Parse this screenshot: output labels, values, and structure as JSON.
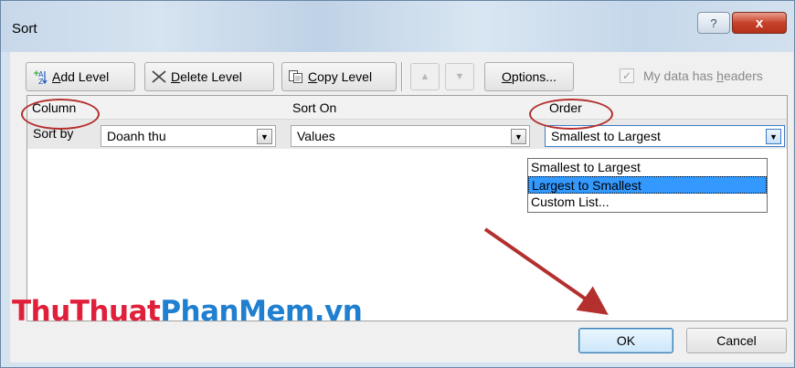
{
  "window": {
    "title": "Sort",
    "help_label": "?",
    "close_label": "x"
  },
  "toolbar": {
    "add_level": {
      "prefix": "",
      "key": "A",
      "rest": "dd Level"
    },
    "delete_level": {
      "prefix": "",
      "key": "D",
      "rest": "elete Level"
    },
    "copy_level": {
      "prefix": "",
      "key": "C",
      "rest": "opy Level"
    },
    "options": {
      "prefix": "",
      "key": "O",
      "rest": "ptions..."
    },
    "has_headers": {
      "prefix": "My data has ",
      "key": "h",
      "rest": "eaders",
      "checked": true
    }
  },
  "columns": {
    "column": "Column",
    "sort_on": "Sort On",
    "order": "Order"
  },
  "row": {
    "label": "Sort by",
    "column_value": "Doanh thu",
    "sort_on_value": "Values",
    "order_value": "Smallest to Largest"
  },
  "order_options": [
    "Smallest to Largest",
    "Largest to Smallest",
    "Custom List..."
  ],
  "order_highlighted_index": 1,
  "watermark": {
    "part1": "ThuThuat",
    "part2": "PhanMem",
    "part3": ".vn"
  },
  "footer": {
    "ok": "OK",
    "cancel": "Cancel"
  },
  "colors": {
    "annotation_red": "#b3302e",
    "selection_blue": "#3399ff",
    "watermark_red": "#e0203b",
    "watermark_blue": "#1f7fd0"
  }
}
